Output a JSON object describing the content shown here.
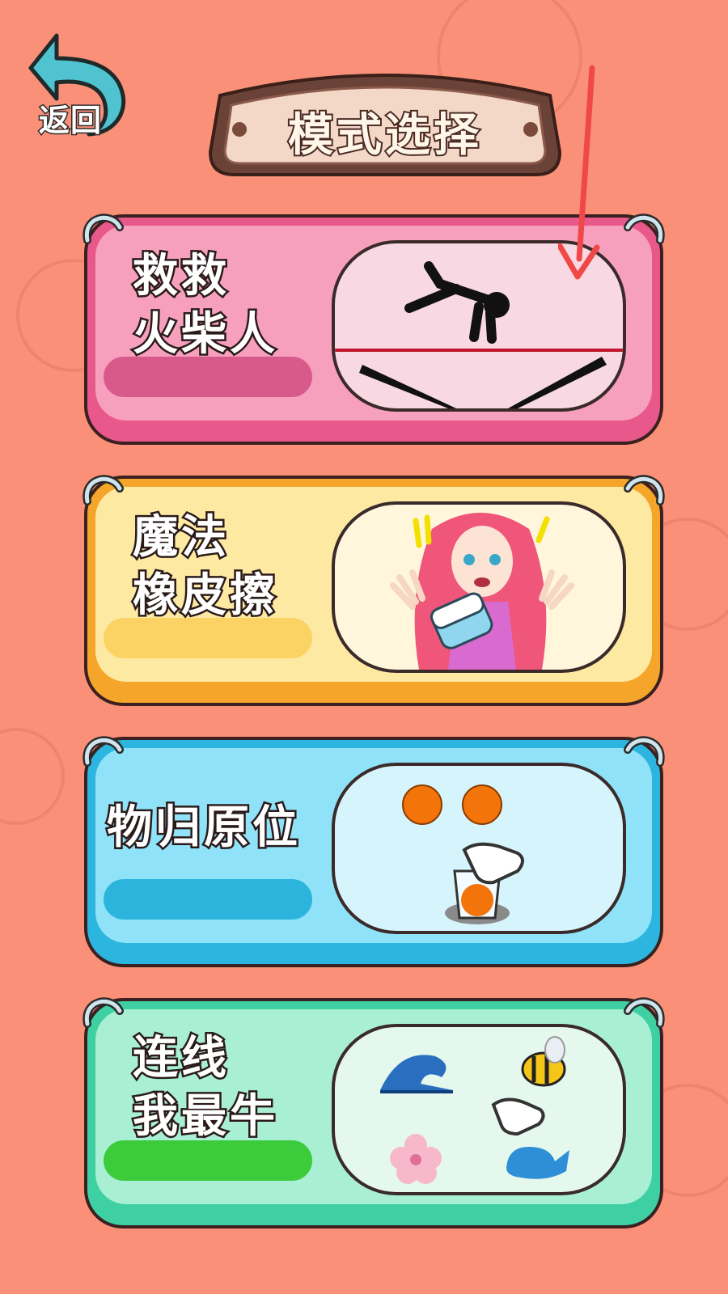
{
  "header": {
    "back_label": "返回",
    "title": "模式选择"
  },
  "modes": [
    {
      "label_line1": "救救",
      "label_line2": "火柴人",
      "icon": "falling-stickman-spikes-icon"
    },
    {
      "label_line1": "魔法",
      "label_line2": "橡皮擦",
      "icon": "girl-with-eraser-icon"
    },
    {
      "label_line1": "物归原位",
      "icon": "oranges-cup-hand-icon"
    },
    {
      "label_line1": "连线",
      "label_line2": "我最牛",
      "icon": "wave-bee-flower-whale-icon"
    }
  ],
  "colors": {
    "background": "#fa9078",
    "card1": "#e9588a",
    "card2": "#f5a52a",
    "card3": "#2cb6df",
    "card4": "#3ed0a3",
    "annotation_arrow": "#f04848"
  }
}
